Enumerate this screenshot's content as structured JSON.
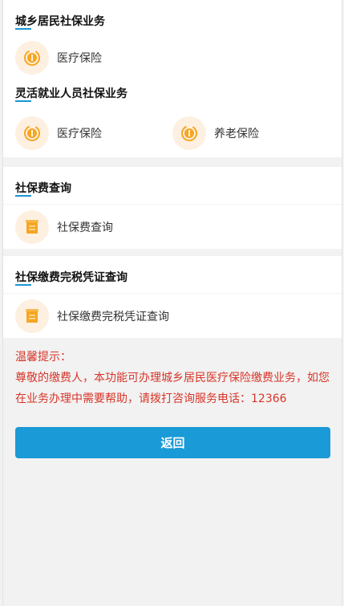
{
  "sections": {
    "urban_rural": {
      "title": "城乡居民社保业务",
      "items": [
        {
          "label": "医疗保险",
          "icon": "coin-icon"
        }
      ]
    },
    "flexible": {
      "title": "灵活就业人员社保业务",
      "items": [
        {
          "label": "医疗保险",
          "icon": "coin-icon"
        },
        {
          "label": "养老保险",
          "icon": "coin-icon"
        }
      ]
    },
    "fee_query": {
      "title": "社保费查询",
      "items": [
        {
          "label": "社保费查询",
          "icon": "document-icon"
        }
      ]
    },
    "tax_certificate": {
      "title": "社保缴费完税凭证查询",
      "items": [
        {
          "label": "社保缴费完税凭证查询",
          "icon": "document-icon"
        }
      ]
    }
  },
  "tip": {
    "heading": "温馨提示：",
    "body": "尊敬的缴费人，本功能可办理城乡居民医疗保险缴费业务，如您在业务办理中需要帮助，请拨打咨询服务电话：12366"
  },
  "back_button": {
    "label": "返回"
  },
  "colors": {
    "accent": "#1a9ad6",
    "tip_text": "#d7362a",
    "icon_bg": "#fdf0e0",
    "icon_fg": "#f5a623"
  }
}
